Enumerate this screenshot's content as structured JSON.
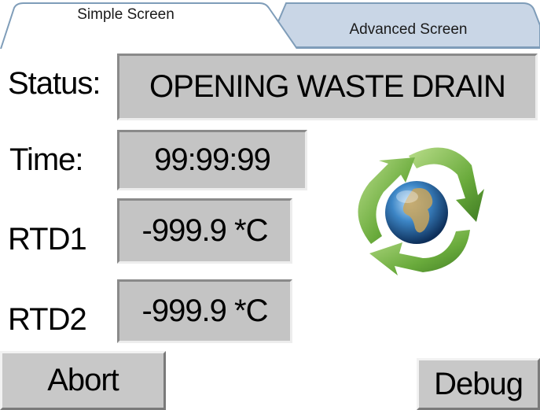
{
  "tabs": [
    {
      "label": "Simple Screen",
      "active": true
    },
    {
      "label": "Advanced Screen",
      "active": false
    }
  ],
  "status": {
    "label": "Status:",
    "value": "OPENING WASTE DRAIN"
  },
  "time": {
    "label": "Time:",
    "value": "99:99:99"
  },
  "rtd1": {
    "label": "RTD1",
    "value": "-999.9 *C"
  },
  "rtd2": {
    "label": "RTD2",
    "value": "-999.9 *C"
  },
  "buttons": {
    "abort": "Abort",
    "debug": "Debug"
  },
  "logo": {
    "icon": "recycle-globe-icon"
  },
  "colors": {
    "tab_inactive": "#c9d6e6",
    "tab_border": "#7f9db9",
    "value_box": "#c4c4c4",
    "button": "#c8c8c8",
    "arrow_green": "#7ab648"
  }
}
